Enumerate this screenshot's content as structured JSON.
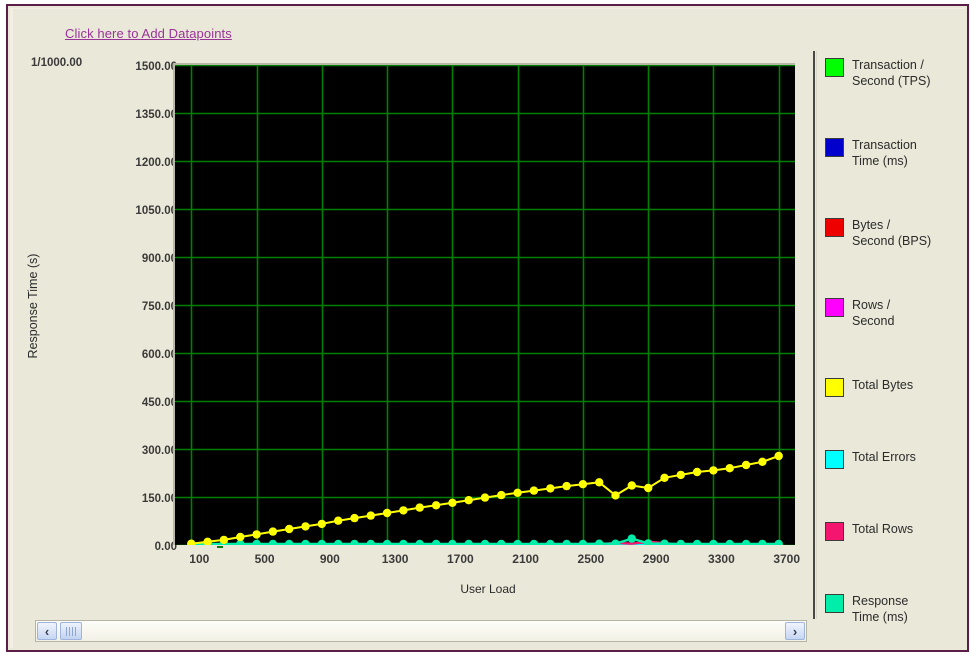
{
  "window": {
    "background": "#eae8d8",
    "frame_color": "#5b1f47"
  },
  "header": {
    "add_datapoints_link": "Click here to Add Datapoints",
    "link_color": "#993399"
  },
  "axis_scale_note": "1/1000.00",
  "scrollbar": {
    "left_arrow": "‹",
    "right_arrow": "›"
  },
  "legend": {
    "items": [
      {
        "label": "Transaction /\nSecond (TPS)",
        "color": "#00ff00"
      },
      {
        "label": "Transaction\nTime (ms)",
        "color": "#0000cc"
      },
      {
        "label": "Bytes /\nSecond (BPS)",
        "color": "#ee0000"
      },
      {
        "label": "Rows /\nSecond",
        "color": "#ff00ff"
      },
      {
        "label": "Total Bytes",
        "color": "#ffff00"
      },
      {
        "label": "Total Errors",
        "color": "#00ffff"
      },
      {
        "label": "Total Rows",
        "color": "#f4156f"
      },
      {
        "label": "Response\nTime (ms)",
        "color": "#00eeaa"
      }
    ]
  },
  "chart_data": {
    "type": "line",
    "title": "",
    "xlabel": "User Load",
    "ylabel": "Response Time (s)",
    "scale_note": "1/1000.00",
    "grid": true,
    "legend_position": "right",
    "plot_background": "#000000",
    "grid_color": "#008000",
    "xlim": [
      0,
      3800
    ],
    "ylim": [
      0,
      1500
    ],
    "ytick_labels": [
      "1500.00",
      "1350.00",
      "1200.00",
      "1050.00",
      "900.00",
      "750.00",
      "600.00",
      "450.00",
      "300.00",
      "150.00",
      "0.00"
    ],
    "ytick_values": [
      1500,
      1350,
      1200,
      1050,
      900,
      750,
      600,
      450,
      300,
      150,
      0
    ],
    "xtick_labels": [
      "100",
      "500",
      "900",
      "1300",
      "1700",
      "2100",
      "2500",
      "2900",
      "3300",
      "3700"
    ],
    "xtick_values": [
      100,
      500,
      900,
      1300,
      1700,
      2100,
      2500,
      2900,
      3300,
      3700
    ],
    "x": [
      100,
      200,
      300,
      400,
      500,
      600,
      700,
      800,
      900,
      1000,
      1100,
      1200,
      1300,
      1400,
      1500,
      1600,
      1700,
      1800,
      1900,
      2000,
      2100,
      2200,
      2300,
      2400,
      2500,
      2600,
      2700,
      2800,
      2900,
      3000,
      3100,
      3200,
      3300,
      3400,
      3500,
      3600,
      3700
    ],
    "series": [
      {
        "name": "Total Bytes",
        "color": "#ffff00",
        "marker": "circle",
        "values": [
          4,
          10,
          16,
          25,
          33,
          42,
          50,
          58,
          66,
          76,
          84,
          92,
          100,
          108,
          117,
          124,
          132,
          140,
          148,
          156,
          163,
          170,
          177,
          184,
          190,
          196,
          155,
          186,
          178,
          210,
          219,
          228,
          233,
          240,
          250,
          260,
          278
        ]
      },
      {
        "name": "Response Time (ms)",
        "color": "#00eeaa",
        "marker": "circle",
        "values": [
          3,
          3,
          3,
          3,
          3,
          3,
          3,
          3,
          3,
          3,
          3,
          3,
          3,
          3,
          3,
          3,
          3,
          3,
          3,
          3,
          3,
          3,
          3,
          3,
          3,
          4,
          4,
          20,
          5,
          4,
          3,
          3,
          3,
          3,
          3,
          3,
          3
        ]
      },
      {
        "name": "Total Rows",
        "color": "#f4156f",
        "marker": "none",
        "values": [
          0,
          0,
          0,
          0,
          0,
          0,
          0,
          0,
          0,
          0,
          0,
          0,
          0,
          0,
          0,
          0,
          0,
          0,
          0,
          0,
          0,
          0,
          0,
          0,
          0,
          2,
          7,
          4,
          10,
          6,
          0,
          0,
          0,
          0,
          0,
          0,
          0
        ]
      },
      {
        "name": "Transaction / Second (TPS)",
        "color": "#00ff00",
        "marker": "none",
        "values": [
          0,
          0,
          0,
          0,
          0,
          0,
          0,
          0,
          0,
          0,
          0,
          0,
          0,
          0,
          0,
          0,
          0,
          0,
          0,
          0,
          0,
          0,
          0,
          0,
          0,
          0,
          0,
          0,
          0,
          0,
          0,
          0,
          0,
          0,
          0,
          0,
          0
        ]
      },
      {
        "name": "Transaction Time (ms)",
        "color": "#0000cc",
        "marker": "none",
        "values": [
          0,
          0,
          0,
          0,
          0,
          0,
          0,
          0,
          0,
          0,
          0,
          0,
          0,
          0,
          0,
          0,
          0,
          0,
          0,
          0,
          0,
          0,
          0,
          0,
          0,
          0,
          0,
          0,
          0,
          0,
          0,
          0,
          0,
          0,
          0,
          0,
          0
        ]
      },
      {
        "name": "Bytes / Second (BPS)",
        "color": "#ee0000",
        "marker": "none",
        "values": [
          0,
          0,
          0,
          0,
          0,
          0,
          0,
          0,
          0,
          0,
          0,
          0,
          0,
          0,
          0,
          0,
          0,
          0,
          0,
          0,
          0,
          0,
          0,
          0,
          0,
          0,
          0,
          0,
          0,
          0,
          0,
          0,
          0,
          0,
          0,
          0,
          0
        ]
      },
      {
        "name": "Rows / Second",
        "color": "#ff00ff",
        "marker": "none",
        "values": [
          0,
          0,
          0,
          0,
          0,
          0,
          0,
          0,
          0,
          0,
          0,
          0,
          0,
          0,
          0,
          0,
          0,
          0,
          0,
          0,
          0,
          0,
          0,
          0,
          0,
          0,
          0,
          0,
          0,
          0,
          0,
          0,
          0,
          0,
          0,
          0,
          0
        ]
      },
      {
        "name": "Total Errors",
        "color": "#00ffff",
        "marker": "none",
        "values": [
          0,
          0,
          0,
          0,
          0,
          0,
          0,
          0,
          0,
          0,
          0,
          0,
          0,
          0,
          0,
          0,
          0,
          0,
          0,
          0,
          0,
          0,
          0,
          0,
          0,
          0,
          0,
          0,
          0,
          0,
          0,
          0,
          0,
          0,
          0,
          0,
          0
        ]
      }
    ]
  }
}
